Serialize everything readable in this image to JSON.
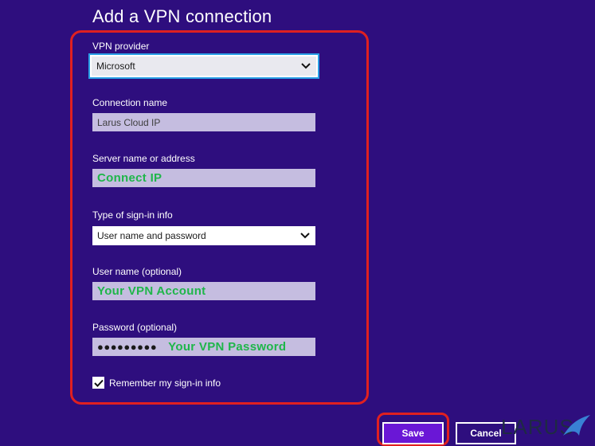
{
  "dialog": {
    "title": "Add a VPN connection"
  },
  "form": {
    "vpn_provider": {
      "label": "VPN provider",
      "value": "Microsoft"
    },
    "connection_name": {
      "label": "Connection name",
      "value": "Larus Cloud IP"
    },
    "server": {
      "label": "Server name or address",
      "value": "Connect IP"
    },
    "sign_in_type": {
      "label": "Type of sign-in info",
      "value": "User name and password"
    },
    "username": {
      "label": "User name (optional)",
      "value": "Your VPN Account"
    },
    "password": {
      "label": "Password (optional)",
      "masked": "●●●●●●●●●",
      "hint": "Your VPN Password"
    },
    "remember": {
      "label": "Remember my sign-in info",
      "checked": true
    }
  },
  "actions": {
    "save_label": "Save",
    "cancel_label": "Cancel"
  },
  "branding": {
    "logo_text": "LARUS"
  },
  "colors": {
    "background": "#2e0e7e",
    "highlight": "#e02020",
    "accent_text": "#1fb64a",
    "focus_ring": "#2aa0e6"
  },
  "icons": {
    "dropdown": "chevron-down-icon",
    "check": "checkmark-icon",
    "logo": "bird-swoosh-icon"
  }
}
